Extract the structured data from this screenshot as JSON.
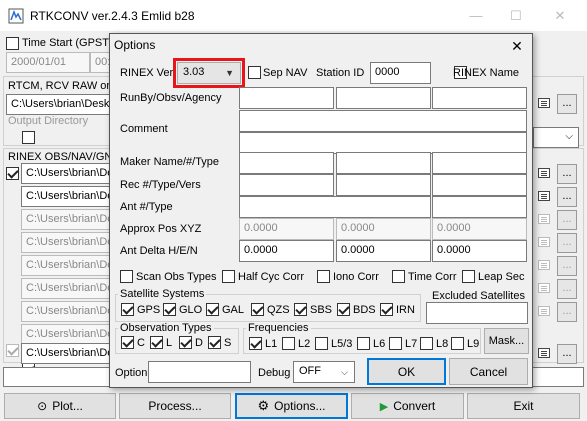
{
  "window": {
    "title": "RTKCONV ver.2.4.3 Emlid b28",
    "controls": {
      "minimize": "—",
      "maximize": "☐",
      "close": "✕"
    }
  },
  "main": {
    "time_start_label": "Time Start (GPST)",
    "time_start_date": "2000/01/01",
    "time_start_time": "00:",
    "rtcm_label": "RTCM, RCV RAW or R",
    "rtcm_path": "C:\\Users\\brian\\Deskt",
    "output_dir_label": "Output Directory",
    "rinex_label": "RINEX OBS/NAV/GNA",
    "rinex_paths": [
      "C:\\Users\\brian\\De",
      "C:\\Users\\brian\\De",
      "C:\\Users\\brian\\De",
      "C:\\Users\\brian\\De",
      "C:\\Users\\brian\\De",
      "C:\\Users\\brian\\De",
      "C:\\Users\\brian\\De",
      "C:\\Users\\brian\\De",
      "C:\\Users\\brian\\De"
    ],
    "dots_label": "...",
    "buttons": {
      "plot": "Plot...",
      "process": "Process...",
      "options": "Options...",
      "convert": "Convert",
      "exit": "Exit"
    },
    "icons": {
      "plot": "plot-icon",
      "options": "gear-icon",
      "convert": "play-arrow-icon"
    },
    "accent": "#0078d7",
    "convert_icon_color": "#1f9a3a"
  },
  "dialog": {
    "title": "Options",
    "close": "✕",
    "rinex_ver_label": "RINEX Ver",
    "rinex_ver_value": "3.03",
    "highlight_color": "#e8161b",
    "sep_nav_label": "Sep NAV",
    "station_id_label": "Station ID",
    "station_id_value": "0000",
    "rinex_name_label": "RINEX Name",
    "runby_label": "RunBy/Obsv/Agency",
    "comment_label": "Comment",
    "maker_label": "Maker Name/#/Type",
    "rec_label": "Rec #/Type/Vers",
    "ant_label": "Ant #/Type",
    "approx_pos_label": "Approx Pos XYZ",
    "approx_pos_values": [
      "0.0000",
      "0.0000",
      "0.0000"
    ],
    "ant_delta_label": "Ant Delta H/E/N",
    "ant_delta_values": [
      "0.0000",
      "0.0000",
      "0.0000"
    ],
    "scan_obs_label": "Scan Obs Types",
    "half_cyc_label": "Half Cyc Corr",
    "iono_label": "Iono Corr",
    "time_corr_label": "Time Corr",
    "leap_sec_label": "Leap Sec",
    "satellite_systems_title": "Satellite Systems",
    "satellite_systems": [
      "GPS",
      "GLO",
      "GAL",
      "QZS",
      "SBS",
      "BDS",
      "IRN"
    ],
    "excluded_satellites_title": "Excluded Satellites",
    "observation_types_title": "Observation Types",
    "observation_types": [
      "C",
      "L",
      "D",
      "S"
    ],
    "frequencies_title": "Frequencies",
    "frequencies": [
      "L1",
      "L2",
      "L5/3",
      "L6",
      "L7",
      "L8",
      "L9"
    ],
    "frequencies_checked": [
      "L1"
    ],
    "mask_label": "Mask...",
    "option_label": "Option",
    "debug_label": "Debug",
    "debug_value": "OFF",
    "ok_label": "OK",
    "cancel_label": "Cancel"
  }
}
